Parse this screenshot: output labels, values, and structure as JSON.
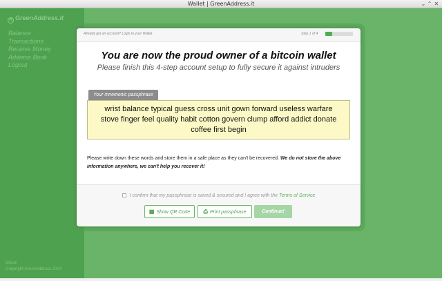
{
  "window": {
    "title": "Wallet | GreenAddress.it",
    "minimize_glyph": "⌄",
    "maximize_glyph": "⌃",
    "close_glyph": "✕"
  },
  "sidebar": {
    "brand": "GreenAddress.it",
    "logo_glyph": "R",
    "items": [
      {
        "label": "Balance"
      },
      {
        "label": "Transactions"
      },
      {
        "label": "Receive Money"
      },
      {
        "label": "Address Book"
      },
      {
        "label": "Logout"
      }
    ],
    "footer_line1": "bitcoin",
    "footer_line2": "Copyright GreenAddress 2014"
  },
  "modal": {
    "login_link": "Already got an account? Login to your Wallet",
    "step_label": "Step 1 of 4",
    "progress_fraction": 0.25,
    "headline": "You are now the proud owner of a bitcoin wallet",
    "subheadline": "Please finish this 4-step account setup to fully secure it against intruders",
    "mnemonic_tag": "Your mnemonic passphrase",
    "mnemonic": "wrist balance typical guess cross unit gown forward useless warfare stove finger feel quality habit cotton govern clump afford addict donate coffee first begin",
    "warning_text": "Please write down these words and store them in a safe place as they can't be recovered.",
    "warning_bold": "We do not store the above information anywhere, we can't help you recover it!",
    "confirm_text": "I confirm that my passphrase is saved & secured and I agree with the",
    "terms_link": "Terms of Service",
    "buttons": {
      "qr": "Show QR Code",
      "print": "Print passphrase",
      "continue": "Continue!"
    },
    "icons": {
      "qr": "qr-code-icon",
      "print": "printer-icon"
    }
  },
  "colors": {
    "overlay_green": "#6bb56b",
    "sidebar_green": "#4ea14e",
    "accent": "#4caf50",
    "passphrase_bg": "#fdf9c6"
  }
}
